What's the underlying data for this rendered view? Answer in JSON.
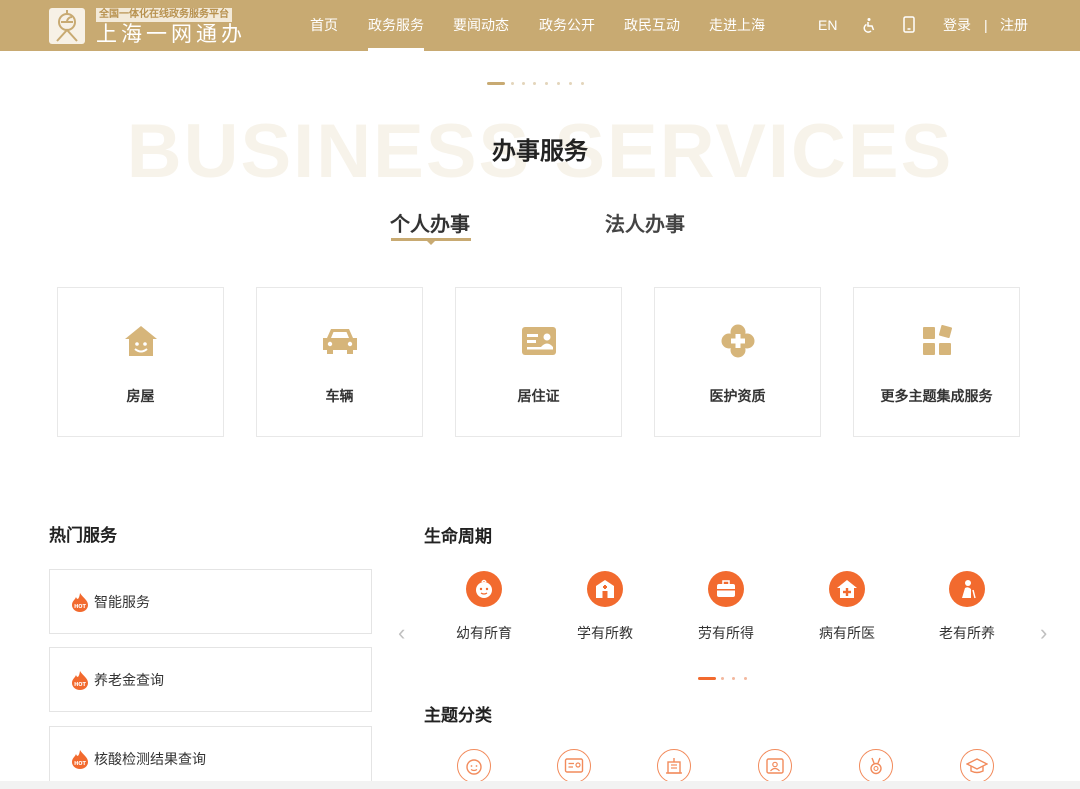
{
  "header": {
    "logo_tag": "全国一体化在线政务服务平台",
    "logo_name": "上海一网通办",
    "nav": [
      "首页",
      "政务服务",
      "要闻动态",
      "政务公开",
      "政民互动",
      "走进上海"
    ],
    "active_nav": "政务服务",
    "lang": "EN",
    "login": "登录",
    "divider": "|",
    "register": "注册"
  },
  "section": {
    "bg_title": "BUSINESS SERVICES",
    "title": "办事服务",
    "tabs": [
      "个人办事",
      "法人办事"
    ],
    "active_tab": "个人办事"
  },
  "cards": [
    {
      "label": "房屋",
      "icon": "house-icon"
    },
    {
      "label": "车辆",
      "icon": "car-icon"
    },
    {
      "label": "居住证",
      "icon": "id-card-icon"
    },
    {
      "label": "医护资质",
      "icon": "medical-icon"
    },
    {
      "label": "更多主题集成服务",
      "icon": "grid-icon"
    }
  ],
  "hot": {
    "title": "热门服务",
    "badge": "HOT",
    "items": [
      "智能服务",
      "养老金查询",
      "核酸检测结果查询"
    ]
  },
  "lifecycle": {
    "title": "生命周期",
    "items": [
      {
        "label": "幼有所育",
        "icon": "baby-icon"
      },
      {
        "label": "学有所教",
        "icon": "school-icon"
      },
      {
        "label": "劳有所得",
        "icon": "briefcase-icon"
      },
      {
        "label": "病有所医",
        "icon": "hospital-icon"
      },
      {
        "label": "老有所养",
        "icon": "elder-icon"
      }
    ],
    "prev": "‹",
    "next": "›"
  },
  "themes": {
    "title": "主题分类",
    "icons": [
      "face-icon",
      "certificate-icon",
      "building-icon",
      "photo-id-icon",
      "medal-icon",
      "graduation-cap-icon"
    ]
  },
  "colors": {
    "brand": "#c8aa72",
    "accent": "#f26a2e"
  }
}
